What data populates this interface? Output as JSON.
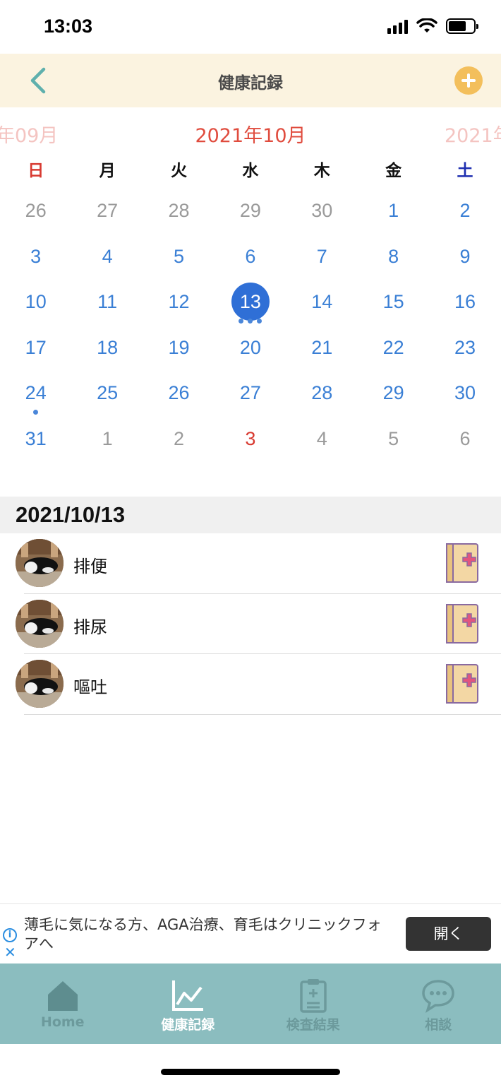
{
  "status_bar": {
    "time": "13:03"
  },
  "header": {
    "title": "健康記録"
  },
  "months": {
    "prev": "年09月",
    "current": "2021年10月",
    "next": "2021年"
  },
  "weekdays": [
    "日",
    "月",
    "火",
    "水",
    "木",
    "金",
    "土"
  ],
  "weekday_colors": [
    "#d83a31",
    "#111111",
    "#111111",
    "#111111",
    "#111111",
    "#111111",
    "#1e2fb0"
  ],
  "calendar": [
    [
      "26",
      "27",
      "28",
      "29",
      "30",
      "1",
      "2"
    ],
    [
      "3",
      "4",
      "5",
      "6",
      "7",
      "8",
      "9"
    ],
    [
      "10",
      "11",
      "12",
      "13",
      "14",
      "15",
      "16"
    ],
    [
      "17",
      "18",
      "19",
      "20",
      "21",
      "22",
      "23"
    ],
    [
      "24",
      "25",
      "26",
      "27",
      "28",
      "29",
      "30"
    ],
    [
      "31",
      "1",
      "2",
      "3",
      "4",
      "5",
      "6"
    ]
  ],
  "selected_date": "2021/10/13",
  "records": [
    {
      "label": "排便",
      "icon": "health-book-icon"
    },
    {
      "label": "排尿",
      "icon": "health-book-icon"
    },
    {
      "label": "嘔吐",
      "icon": "health-book-icon"
    }
  ],
  "ad": {
    "text": "薄毛に気になる方、AGA治療、育毛はクリニックフォアへ",
    "button": "開く"
  },
  "tabs": [
    {
      "label": "Home",
      "icon": "home-icon",
      "active": false
    },
    {
      "label": "健康記録",
      "icon": "chart-line-icon",
      "active": true
    },
    {
      "label": "検査結果",
      "icon": "clipboard-icon",
      "active": false
    },
    {
      "label": "相談",
      "icon": "chat-bubble-icon",
      "active": false
    }
  ],
  "colors": {
    "header_bg": "#fbf3e0",
    "accent_blue": "#2f6fd6",
    "holiday_red": "#d83a31",
    "tabbar_bg": "#8bbdbf",
    "add_button": "#f3bf5c"
  }
}
